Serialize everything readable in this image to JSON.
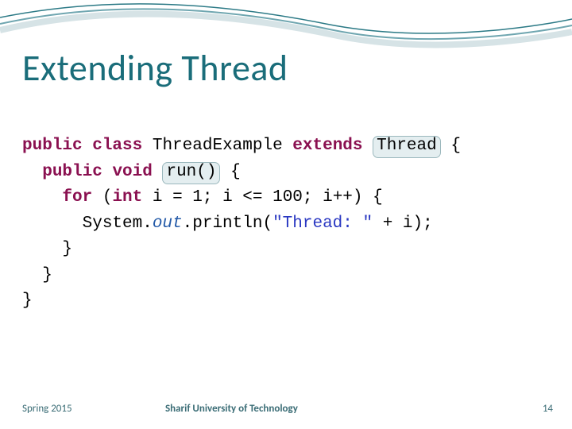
{
  "slide": {
    "title": "Extending Thread"
  },
  "code": {
    "l1a": "public",
    "l1b": " class",
    "l1c": " ThreadExample ",
    "l1d": "extends",
    "l1e": "Thread",
    "l1f": "{",
    "l2a": "public",
    "l2b": " void",
    "l2c": "run()",
    "l2d": " {",
    "l3a": "for",
    "l3b": " (",
    "l3c": "int",
    "l3d": " i = 1; i <= 100; i++) {",
    "l4a": "      System.",
    "l4b": "out",
    "l4c": ".println(",
    "l4d": "\"Thread: \"",
    "l4e": " + i);",
    "l5": "    }",
    "l6": "  }",
    "l7": "}"
  },
  "footer": {
    "term": "Spring 2015",
    "university": "Sharif University of Technology",
    "page": "14"
  }
}
